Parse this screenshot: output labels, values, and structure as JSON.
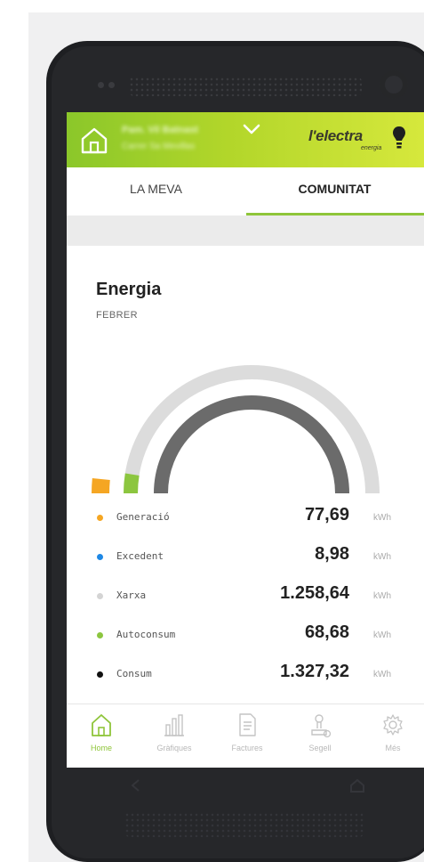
{
  "header": {
    "address_line1": "Pam. Vil Batnast",
    "address_line2": "Carrer Sa Mevillas",
    "logo_text": "l'electra",
    "logo_sub": "energia"
  },
  "tabs": [
    {
      "label": "LA MEVA",
      "active": false
    },
    {
      "label": "COMUNITAT",
      "active": true
    }
  ],
  "energy": {
    "title": "Energia",
    "period": "FEBRER",
    "gauge": {
      "generacio_fraction": 0.06,
      "autoconsum_fraction": 0.05,
      "colors": {
        "outer": "#dcdcdc",
        "inner": "#6b6b6b",
        "generacio": "#f5a623",
        "autoconsum": "#8cc63f"
      }
    },
    "rows": [
      {
        "label": "Generació",
        "value": "77,69",
        "unit": "kWh",
        "color": "#f5a623"
      },
      {
        "label": "Excedent",
        "value": "8,98",
        "unit": "kWh",
        "color": "#1e88e5"
      },
      {
        "label": "Xarxa",
        "value": "1.258,64",
        "unit": "kWh",
        "color": "#d4d4d4"
      },
      {
        "label": "Autoconsum",
        "value": "68,68",
        "unit": "kWh",
        "color": "#8cc63f"
      },
      {
        "label": "Consum",
        "value": "1.327,32",
        "unit": "kWh",
        "color": "#111111"
      }
    ]
  },
  "nav": [
    {
      "label": "Home",
      "icon": "home-icon",
      "active": true
    },
    {
      "label": "Gràfiques",
      "icon": "bar-chart-icon",
      "active": false
    },
    {
      "label": "Factures",
      "icon": "document-icon",
      "active": false
    },
    {
      "label": "Segell",
      "icon": "seal-icon",
      "active": false
    },
    {
      "label": "Més",
      "icon": "gear-icon",
      "active": false
    }
  ]
}
